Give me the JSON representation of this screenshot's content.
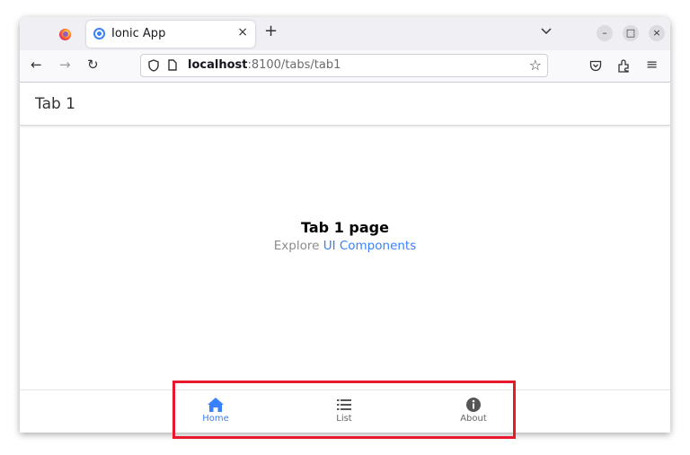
{
  "browser": {
    "tab_title": "Ionic App",
    "tab_close": "×",
    "new_tab": "+",
    "tab_list": "⌄",
    "window_controls": {
      "minimize": "–",
      "maximize": "□",
      "close": "×"
    },
    "url_host": "localhost",
    "url_rest": ":8100/tabs/tab1",
    "nav": {
      "back": "←",
      "forward": "→",
      "reload": "↻"
    },
    "toolbar_icons": {
      "bookmark": "☆",
      "pocket": "pocket-icon",
      "extensions": "extensions-icon",
      "menu": "≡"
    }
  },
  "app": {
    "header_title": "Tab 1",
    "content": {
      "title": "Tab 1 page",
      "subtitle_prefix": "Explore ",
      "subtitle_link": "UI Components"
    },
    "tabs": [
      {
        "label": "Home",
        "icon": "home-icon",
        "selected": true
      },
      {
        "label": "List",
        "icon": "list-icon",
        "selected": false
      },
      {
        "label": "About",
        "icon": "info-icon",
        "selected": false
      }
    ],
    "accent_color": "#3880ff",
    "highlight_color": "#e8192c"
  }
}
